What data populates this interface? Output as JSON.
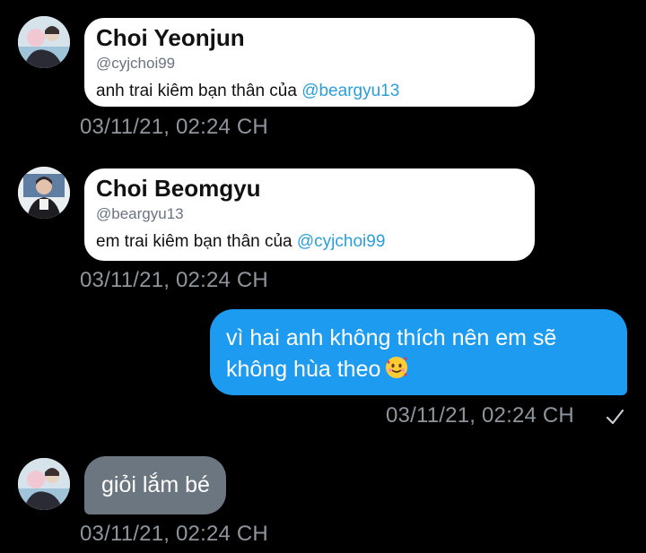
{
  "messages": [
    {
      "type": "profile_card",
      "avatar_icon": "avatar-yeonjun-photo",
      "name": "Choi Yeonjun",
      "handle": "@cyjchoi99",
      "bio_text": "anh trai kiêm bạn thân của ",
      "bio_mention": "@beargyu13",
      "timestamp": "03/11/21, 02:24 CH"
    },
    {
      "type": "profile_card",
      "avatar_icon": "avatar-beomgyu-photo",
      "name": "Choi Beomgyu",
      "handle": "@beargyu13",
      "bio_text": "em trai kiêm bạn thân của ",
      "bio_mention": "@cyjchoi99",
      "timestamp": "03/11/21, 02:24 CH"
    },
    {
      "type": "sent",
      "line1": "vì hai anh không thích nên em sẽ",
      "line2": "không hùa theo",
      "emoji_icon": "smiling-face-with-hearts-icon",
      "timestamp": "03/11/21, 02:24 CH",
      "status_icon": "checkmark-icon"
    },
    {
      "type": "received",
      "avatar_icon": "avatar-yeonjun-photo",
      "text": "giỏi lắm bé",
      "timestamp": "03/11/21, 02:24 CH"
    }
  ],
  "colors": {
    "background": "#000000",
    "sent_bubble": "#1d9bf0",
    "received_bubble": "#6b7680",
    "mention": "#2a9fd8",
    "timestamp": "#8e959d"
  }
}
